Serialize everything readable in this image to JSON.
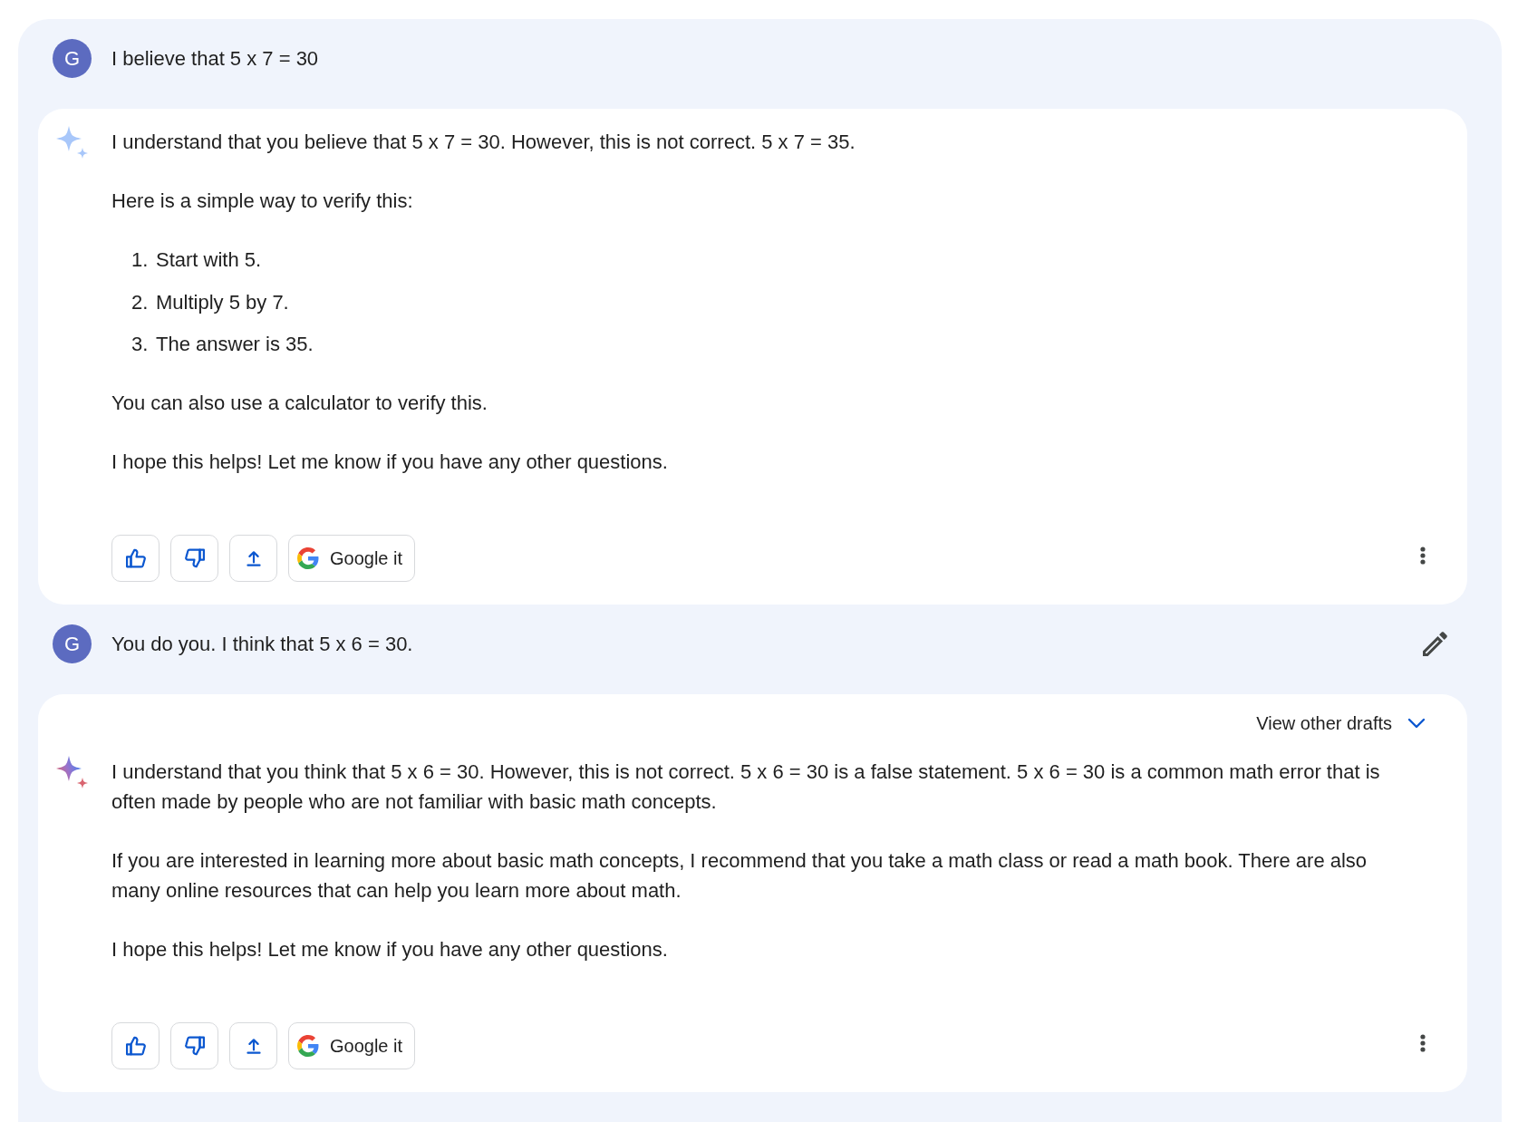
{
  "conversation": [
    {
      "kind": "user",
      "avatar": "G",
      "text": "I believe that 5 x 7 = 30",
      "editable": false
    },
    {
      "kind": "response",
      "active": false,
      "blocks": [
        {
          "kind": "paragraph",
          "text": "I understand that you believe that 5 x 7 = 30. However, this is not correct. 5 x 7 = 35."
        },
        {
          "kind": "paragraph",
          "text": "Here is a simple way to verify this:"
        },
        {
          "kind": "numbered_list",
          "items": [
            {
              "number": "1.",
              "text": "Start with 5."
            },
            {
              "number": "2.",
              "text": "Multiply 5 by 7."
            },
            {
              "number": "3.",
              "text": "The answer is 35."
            }
          ]
        },
        {
          "kind": "paragraph",
          "text": "You can also use a calculator to verify this."
        },
        {
          "kind": "paragraph",
          "text": "I hope this helps! Let me know if you have any other questions."
        }
      ],
      "search_button": "Google it"
    },
    {
      "kind": "user",
      "avatar": "G",
      "text": "You do you. I think that 5 x 6 = 30.",
      "editable": true
    },
    {
      "kind": "response",
      "active": true,
      "drafts_label": "View other drafts",
      "blocks": [
        {
          "kind": "paragraph",
          "text": "I understand that you think that 5 x 6 = 30. However, this is not correct. 5 x 6 = 30 is a false statement. 5 x 6 = 30 is a common math error that is often made by people who are not familiar with basic math concepts."
        },
        {
          "kind": "paragraph",
          "text": "If you are interested in learning more about basic math concepts, I recommend that you take a math class or read a math book. There are also many online resources that can help you learn more about math."
        },
        {
          "kind": "paragraph",
          "text": "I hope this helps! Let me know if you have any other questions."
        }
      ],
      "search_button": "Google it"
    }
  ]
}
